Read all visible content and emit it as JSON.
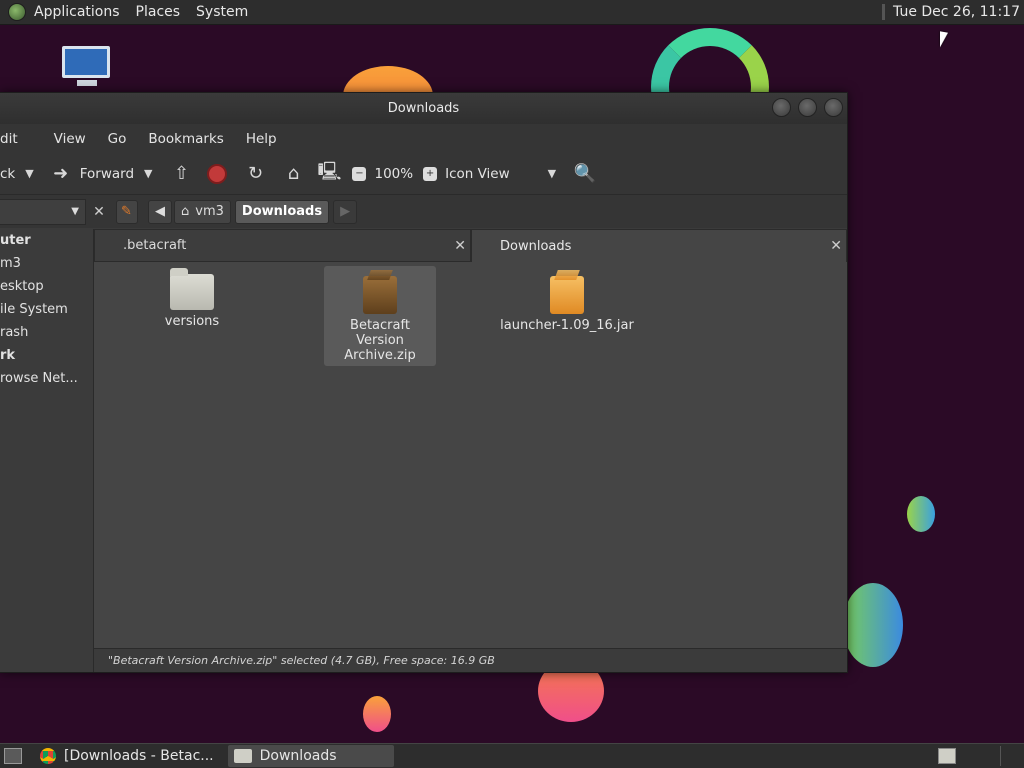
{
  "top_panel": {
    "menus": [
      "Applications",
      "Places",
      "System"
    ],
    "clock": "Tue Dec 26, 11:17"
  },
  "window": {
    "title": "Downloads",
    "menubar": [
      "dit",
      "View",
      "Go",
      "Bookmarks",
      "Help"
    ],
    "toolbar": {
      "back_label": "ck",
      "forward_label": "Forward",
      "zoom": "100%",
      "view_mode": "Icon View"
    },
    "path": {
      "crumbs": [
        "vm3",
        "Downloads"
      ]
    },
    "sidebar": {
      "items": [
        {
          "label": "uter",
          "head": true
        },
        {
          "label": "m3",
          "head": false
        },
        {
          "label": "esktop",
          "head": false
        },
        {
          "label": "ile System",
          "head": false
        },
        {
          "label": "rash",
          "head": false
        },
        {
          "label": "rk",
          "head": true
        },
        {
          "label": "rowse Net...",
          "head": false
        }
      ]
    },
    "tabs": [
      {
        "label": ".betacraft",
        "active": false
      },
      {
        "label": "Downloads",
        "active": true
      }
    ],
    "files": [
      {
        "name": "versions",
        "kind": "folder",
        "selected": false
      },
      {
        "name": "Betacraft Version Archive.zip",
        "kind": "archive",
        "selected": true
      },
      {
        "name": "launcher-1.09_16.jar",
        "kind": "jar",
        "selected": false
      }
    ],
    "status": "\"Betacraft Version Archive.zip\" selected (4.7 GB), Free space: 16.9 GB"
  },
  "taskbar": {
    "tasks": [
      {
        "label": "[Downloads - Betac...",
        "icon": "chrome-icon",
        "active": false
      },
      {
        "label": "Downloads",
        "icon": "folder-icon",
        "active": true
      }
    ]
  },
  "colors": {
    "desktop_bg": "#2b0a26",
    "panel_bg": "#2d2d2d",
    "window_bg": "#3b3b3b",
    "selection": "#5a5a5a"
  }
}
